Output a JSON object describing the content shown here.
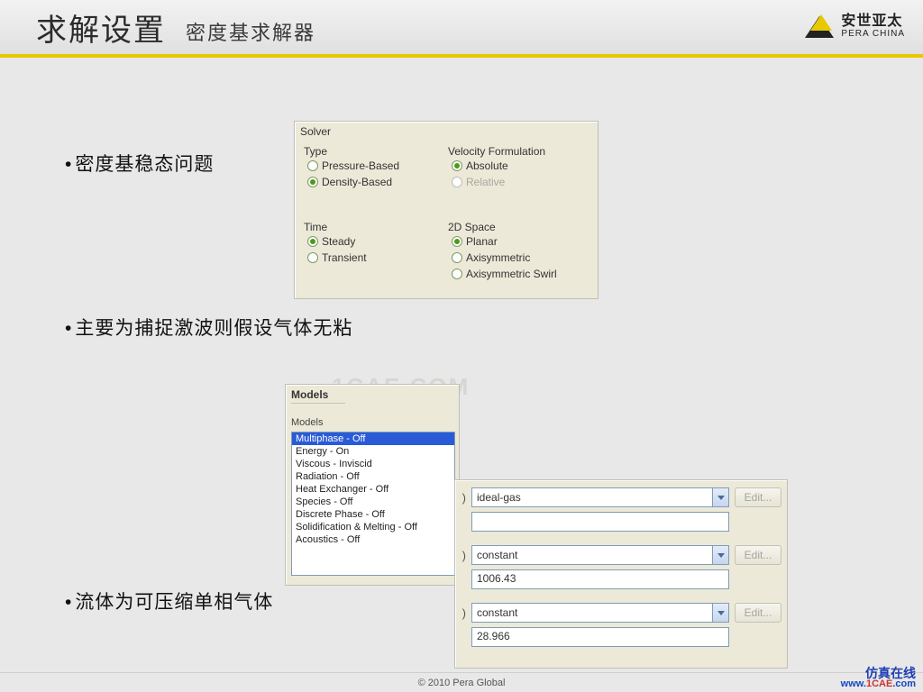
{
  "header": {
    "title_main": "求解设置",
    "title_sub": "密度基求解器",
    "logo_cn": "安世亚太",
    "logo_en": "PERA CHINA"
  },
  "bullets": {
    "b1": "密度基稳态问题",
    "b2": "主要为捕捉激波则假设气体无粘",
    "b3": "流体为可压缩单相气体"
  },
  "solver": {
    "panel_label": "Solver",
    "type_label": "Type",
    "type_options": [
      "Pressure-Based",
      "Density-Based"
    ],
    "type_selected": 1,
    "vel_label": "Velocity Formulation",
    "vel_options": [
      "Absolute",
      "Relative"
    ],
    "vel_selected": 0,
    "vel_disabled_index": 1,
    "time_label": "Time",
    "time_options": [
      "Steady",
      "Transient"
    ],
    "time_selected": 0,
    "space_label": "2D Space",
    "space_options": [
      "Planar",
      "Axisymmetric",
      "Axisymmetric Swirl"
    ],
    "space_selected": 0
  },
  "models": {
    "title": "Models",
    "label": "Models",
    "items": [
      "Multiphase - Off",
      "Energy - On",
      "Viscous - Inviscid",
      "Radiation - Off",
      "Heat Exchanger - Off",
      "Species - Off",
      "Discrete Phase - Off",
      "Solidification & Melting - Off",
      "Acoustics - Off"
    ],
    "selected_index": 0
  },
  "properties": {
    "rows": [
      {
        "combo": "ideal-gas",
        "value": ""
      },
      {
        "combo": "constant",
        "value": "1006.43"
      },
      {
        "combo": "constant",
        "value": "28.966"
      }
    ],
    "edit_label": "Edit..."
  },
  "watermark": "1CAE.COM",
  "footer": {
    "copyright": "© 2010 Pera Global",
    "brand_cn": "仿真在线",
    "url_w": "www.",
    "url_dom": "1CAE",
    "url_tld": ".com"
  }
}
